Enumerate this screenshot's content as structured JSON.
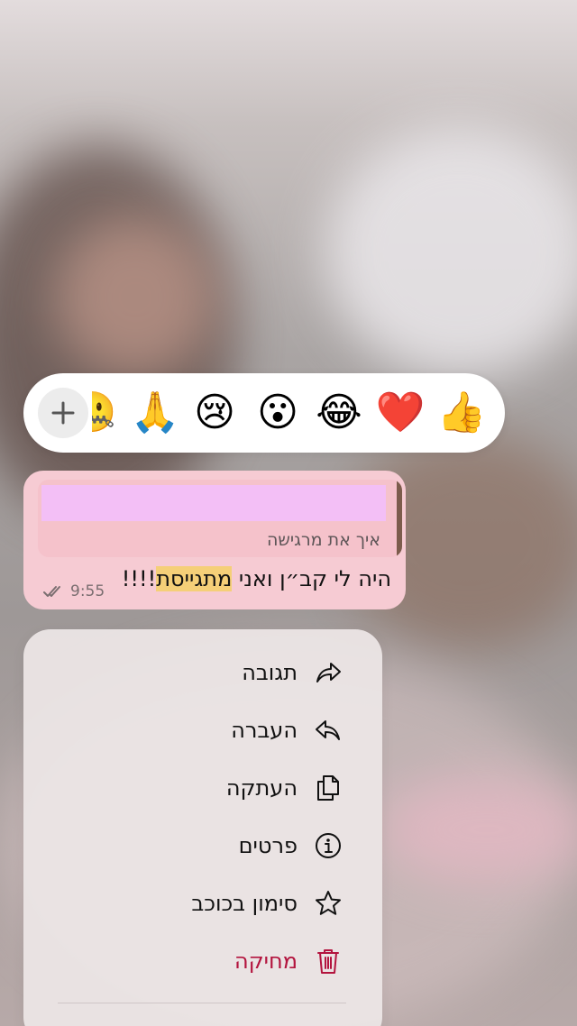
{
  "reactions": {
    "add_label": "+",
    "emojis": [
      {
        "name": "thumbs-up",
        "glyph": "👍"
      },
      {
        "name": "red-heart",
        "glyph": "❤️"
      },
      {
        "name": "tears-of-joy",
        "glyph": "😂"
      },
      {
        "name": "surprised",
        "glyph": "😮"
      },
      {
        "name": "crying",
        "glyph": "😢"
      },
      {
        "name": "folded-hands",
        "glyph": "🙏"
      },
      {
        "name": "partial",
        "glyph": "🤐"
      }
    ]
  },
  "message": {
    "quoted_text": "איך את מרגישה",
    "text_before": "היה לי קב״ן ואני ",
    "text_highlight": "מתגייסת",
    "text_after": "!!!!",
    "time": "9:55",
    "status": "read",
    "bubble_color": "#f6cbd3",
    "highlight_color": "#f5cf78"
  },
  "menu": {
    "items": [
      {
        "label": "תגובה",
        "icon": "reply-arrow-icon"
      },
      {
        "label": "העברה",
        "icon": "forward-arrow-icon"
      },
      {
        "label": "העתקה",
        "icon": "copy-icon"
      },
      {
        "label": "פרטים",
        "icon": "info-icon"
      },
      {
        "label": "סימון בכוכב",
        "icon": "star-icon"
      },
      {
        "label": "מחיקה",
        "icon": "trash-icon",
        "danger": true
      }
    ],
    "danger_color": "#b3143e"
  }
}
